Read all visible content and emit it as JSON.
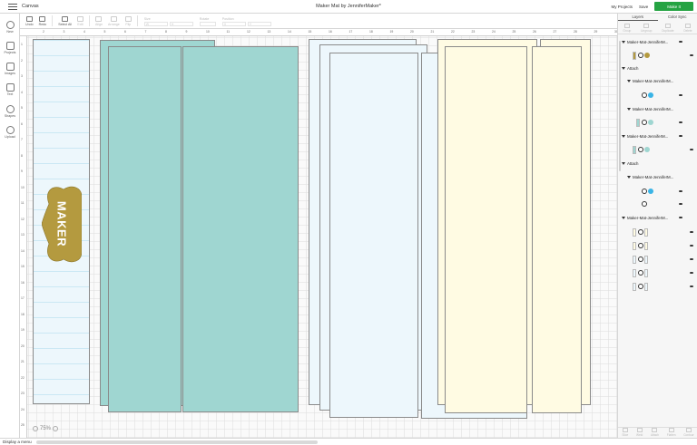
{
  "topbar": {
    "section": "Canvas",
    "doc_title": "Maker Mat by JenniferMaker*",
    "my_projects": "My Projects",
    "save": "Save",
    "make_it": "Make It"
  },
  "toolbar": {
    "undo": "Undo",
    "redo": "Redo",
    "select_all": "Select All",
    "edit": "Edit",
    "align": "Align",
    "arrange": "Arrange",
    "flip": "Flip",
    "size": "Size",
    "size_w": "W",
    "size_h": "H",
    "rotate": "Rotate",
    "position": "Position",
    "pos_x": "X",
    "pos_y": "Y"
  },
  "leftbar": {
    "items": [
      {
        "label": "New"
      },
      {
        "label": "Projects"
      },
      {
        "label": "Images"
      },
      {
        "label": "Text"
      },
      {
        "label": "Shapes"
      },
      {
        "label": "Upload"
      }
    ]
  },
  "ruler": {
    "top": [
      "2",
      "3",
      "4",
      "5",
      "6",
      "7",
      "8",
      "9",
      "10",
      "11",
      "12",
      "13",
      "14",
      "15",
      "16",
      "17",
      "18",
      "19",
      "20",
      "21",
      "22",
      "23",
      "24",
      "25",
      "26",
      "27",
      "28",
      "29",
      "30"
    ],
    "left": [
      "1",
      "2",
      "3",
      "4",
      "5",
      "6",
      "7",
      "8",
      "9",
      "10",
      "11",
      "12",
      "13",
      "14",
      "15",
      "16",
      "17",
      "18",
      "19",
      "20",
      "21",
      "22",
      "23",
      "24",
      "25"
    ]
  },
  "canvas": {
    "heart_text": "MAKER",
    "zoom": "75%"
  },
  "colors": {
    "teal": "#9fd6d1",
    "light_blue": "#edf7fc",
    "cream": "#fffbe3",
    "gold": "#b49a3f",
    "accent_blue": "#3ab4e6",
    "make_green": "#25a343"
  },
  "layers_panel": {
    "tabs": [
      "Layers",
      "Color Sync"
    ],
    "actions": [
      "Group",
      "Ungroup",
      "Duplicate",
      "Delete"
    ],
    "groups": [
      {
        "name": "Maker-Mat-JenniferM..."
      },
      {
        "name": "Attach"
      },
      {
        "name": "Maker-Mat-JenniferM..."
      },
      {
        "name": "Maker-Mat-JenniferM..."
      },
      {
        "name": "Maker-Mat-JenniferM..."
      },
      {
        "name": "Attach"
      },
      {
        "name": "Maker-Mat-JenniferM..."
      },
      {
        "name": "Maker-Mat-JenniferM..."
      }
    ],
    "footer": [
      "Slice",
      "Weld",
      "Attach",
      "Flatten",
      "Contour"
    ]
  },
  "status": {
    "text": "Display a menu"
  }
}
